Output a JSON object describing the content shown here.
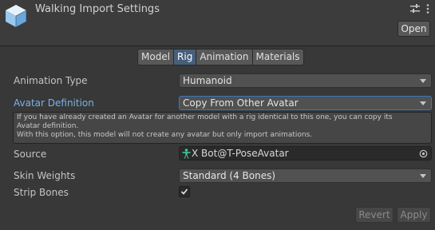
{
  "header": {
    "title": "Walking Import Settings",
    "open_label": "Open"
  },
  "tabs": [
    {
      "label": "Model",
      "active": false
    },
    {
      "label": "Rig",
      "active": true
    },
    {
      "label": "Animation",
      "active": false
    },
    {
      "label": "Materials",
      "active": false
    }
  ],
  "rig": {
    "animation_type": {
      "label": "Animation Type",
      "value": "Humanoid"
    },
    "avatar_definition": {
      "label": "Avatar Definition",
      "value": "Copy From Other Avatar"
    },
    "help_lines": [
      "If you have already created an Avatar for another model with a rig identical to this one, you can copy its",
      "Avatar definition.",
      "With this option, this model will not create any avatar but only import animations."
    ],
    "source": {
      "label": "Source",
      "value": "X Bot@T-PoseAvatar"
    },
    "skin_weights": {
      "label": "Skin Weights",
      "value": "Standard (4 Bones)"
    },
    "strip_bones": {
      "label": "Strip Bones",
      "checked": true
    }
  },
  "footer": {
    "revert_label": "Revert",
    "apply_label": "Apply"
  },
  "colors": {
    "background": "#383838",
    "accent_blue": "#46607c",
    "focused_label": "#7bb1e8",
    "avatar_icon": "#41c4a0"
  },
  "icons": {
    "asset": "model-prefab-icon",
    "settings": "sliders-icon",
    "menu": "kebab-menu-icon",
    "avatar": "avatar-figure-icon",
    "picker": "object-picker-icon",
    "check": "checkmark-icon"
  }
}
